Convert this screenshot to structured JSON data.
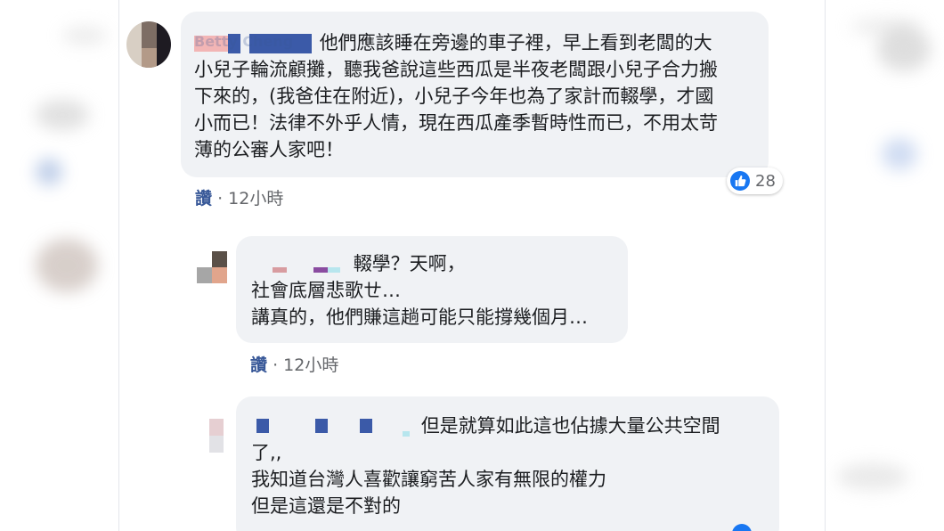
{
  "comments": [
    {
      "author": "Betty Cheng",
      "lines": [
        "他們應該睡在旁邊的車子裡，早上看到老闆的大",
        "小兒子輪流顧攤，聽我爸說這些西瓜是半夜老闆跟小兒子合力搬",
        "下來的，(我爸住在附近)，小兒子今年也為了家計而輟學，才國",
        "小而已！法律不外乎人情，現在西瓜產季暫時性而已，不用太苛",
        "薄的公審人家吧！"
      ],
      "like_label": "讚",
      "separator": "·",
      "time": "12小時",
      "reaction_count": "28",
      "reaction_icon": "thumbs-up-icon"
    },
    {
      "lines": [
        "輟學？天啊，",
        "社會底層悲歌ㄝ…",
        "講真的，他們賺這趟可能只能撐幾個月…"
      ],
      "like_label": "讚",
      "separator": "·",
      "time": "12小時"
    },
    {
      "lines": [
        "但是就算如此這也佔據大量公共空間",
        "了,,",
        "我知道台灣人喜歡讓窮苦人家有無限的權力",
        "但是這還是不對的"
      ]
    }
  ],
  "colors": {
    "bubble": "#f0f2f5",
    "like_link": "#385898",
    "meta": "#65676b",
    "reaction_blue": "#1877f2",
    "name_redaction_pink": "#f2b5b5",
    "name_redaction_blue": "#3b5aa8"
  }
}
